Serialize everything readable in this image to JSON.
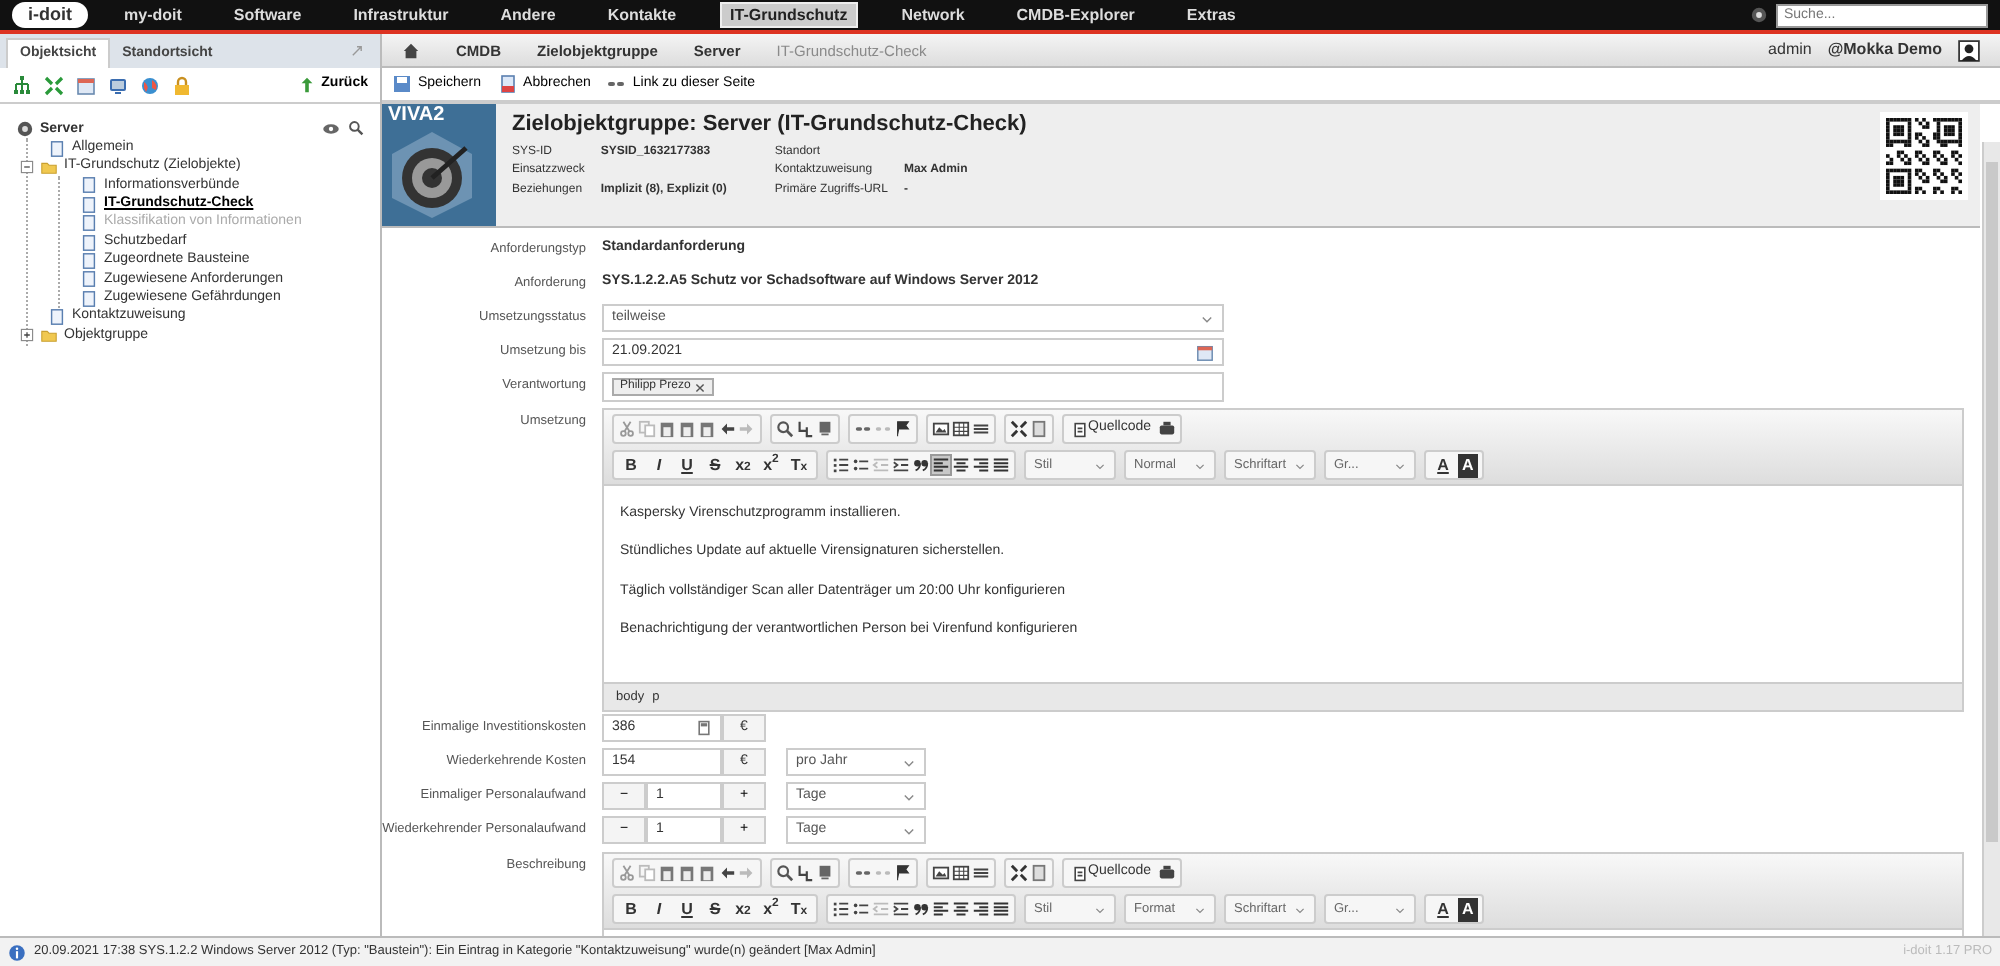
{
  "nav": {
    "logo": "i-doit",
    "items": [
      {
        "label": "my-doit",
        "selected": false
      },
      {
        "label": "Software",
        "selected": false
      },
      {
        "label": "Infrastruktur",
        "selected": false
      },
      {
        "label": "Andere",
        "selected": false
      },
      {
        "label": "Kontakte",
        "selected": false
      },
      {
        "label": "IT-Grundschutz",
        "selected": true
      },
      {
        "label": "Network",
        "selected": false
      },
      {
        "label": "CMDB-Explorer",
        "selected": false
      },
      {
        "label": "Extras",
        "selected": false
      }
    ],
    "search": {
      "placeholder": "Suche..."
    }
  },
  "sidebar": {
    "tabs": [
      {
        "label": "Objektsicht",
        "selected": true
      },
      {
        "label": "Standortsicht",
        "selected": false
      }
    ],
    "back": "Zurück",
    "tree": {
      "label": "Server",
      "children": [
        {
          "label": "Allgemein",
          "kind": "page",
          "selected": false,
          "disabled": false
        },
        {
          "label": "IT-Grundschutz (Zielobjekte)",
          "kind": "folder",
          "expanded": true,
          "selected": false,
          "disabled": false,
          "children": [
            {
              "label": "Informationsverbünde",
              "kind": "page",
              "selected": false,
              "disabled": false
            },
            {
              "label": "IT-Grundschutz-Check",
              "kind": "page",
              "selected": true,
              "disabled": false
            },
            {
              "label": "Klassifikation von Informationen",
              "kind": "page",
              "selected": false,
              "disabled": true
            },
            {
              "label": "Schutzbedarf",
              "kind": "page",
              "selected": false,
              "disabled": false
            },
            {
              "label": "Zugeordnete Bausteine",
              "kind": "page",
              "selected": false,
              "disabled": false
            },
            {
              "label": "Zugewiesene Anforderungen",
              "kind": "page",
              "selected": false,
              "disabled": false
            },
            {
              "label": "Zugewiesene Gefährdungen",
              "kind": "page",
              "selected": false,
              "disabled": false
            }
          ]
        },
        {
          "label": "Kontaktzuweisung",
          "kind": "page",
          "selected": false,
          "disabled": false
        },
        {
          "label": "Objektgruppe",
          "kind": "folder",
          "expanded": false,
          "selected": false,
          "disabled": false
        }
      ]
    }
  },
  "breadcrumb": [
    {
      "label": "CMDB",
      "selected": false
    },
    {
      "label": "Zielobjektgruppe",
      "selected": false
    },
    {
      "label": "Server",
      "selected": false
    },
    {
      "label": "IT-Grundschutz-Check",
      "selected": true
    }
  ],
  "user": {
    "name": "admin",
    "tenant": "@Mokka Demo"
  },
  "actions": [
    {
      "kind": "save",
      "label": "Speichern"
    },
    {
      "kind": "cancel",
      "label": "Abbrechen"
    },
    {
      "kind": "link",
      "label": "Link zu dieser Seite"
    }
  ],
  "header": {
    "logo_text": "VIVA2",
    "title": "Zielobjektgruppe: Server (IT-Grundschutz-Check)",
    "fields_left": [
      {
        "label": "SYS-ID",
        "value": "SYSID_1632177383"
      },
      {
        "label": "Einsatzzweck"
      },
      {
        "label": "Beziehungen",
        "value": "Implizit (8), Explizit (0)"
      }
    ],
    "fields_right": [
      {
        "label": "Standort"
      },
      {
        "label": "Kontaktzuweisung",
        "value": "Max Admin"
      },
      {
        "label": "Primäre Zugriffs-URL",
        "value": "-"
      }
    ]
  },
  "form": [
    {
      "kind": "text",
      "label": "Anforderungstyp",
      "value": "Standardanforderung"
    },
    {
      "kind": "text",
      "label": "Anforderung",
      "value": "SYS.1.2.2.A5 Schutz vor Schadsoftware auf Windows Server 2012"
    },
    {
      "kind": "select",
      "label": "Umsetzungsstatus",
      "value": "teilweise"
    },
    {
      "kind": "date",
      "label": "Umsetzung bis",
      "value": "21.09.2021"
    },
    {
      "kind": "tags",
      "label": "Verantwortung",
      "tags": [
        "Philipp Prezo"
      ]
    },
    {
      "kind": "editor",
      "label": "Umsetzung",
      "source_label": "Quellcode",
      "format_buttons": [
        "B",
        "I",
        "U",
        "S",
        "x$_{2}$",
        "x$^{2}$",
        "T$_{x}$"
      ],
      "left_align_active": true,
      "styles": [
        "Stil",
        "Normal",
        "Schriftart",
        "Gr..."
      ],
      "color_buttons": [
        "A",
        "A"
      ],
      "paragraphs": [
        "Kaspersky Virenschutzprogramm installieren.",
        "Stündliches Update auf aktuelle Virensignaturen sicherstellen.",
        "Täglich vollständiger Scan aller Datenträger um 20:00 Uhr konfigurieren",
        "Benachrichtigung der verantwortlichen Person bei Virenfund konfigurieren"
      ],
      "path": [
        "body",
        "p"
      ]
    },
    {
      "kind": "currency",
      "label": "Einmalige Investitionskosten",
      "value": "386",
      "unit": "€"
    },
    {
      "kind": "currency",
      "label": "Wiederkehrende Kosten",
      "value": "154",
      "unit": "€",
      "period": "pro Jahr"
    },
    {
      "kind": "stepper",
      "label": "Einmaliger Personalaufwand",
      "value": "1",
      "minus": "−",
      "plus": "+",
      "period": "Tage"
    },
    {
      "kind": "stepper",
      "label": "Wiederkehrender Personalaufwand",
      "value": "1",
      "minus": "−",
      "plus": "+",
      "period": "Tage"
    },
    {
      "kind": "editor",
      "label": "Beschreibung",
      "source_label": "Quellcode",
      "format_buttons": [
        "B",
        "I",
        "U",
        "S",
        "x$_{2}$",
        "x$^{2}$",
        "T$_{x}$"
      ],
      "left_align_active": false,
      "styles": [
        "Stil",
        "Format",
        "Schriftart",
        "Gr..."
      ],
      "color_buttons": [
        "A",
        "A"
      ]
    }
  ],
  "status_bar": {
    "message": "20.09.2021 17:38 SYS.1.2.2 Windows Server 2012 (Typ: \"Baustein\"): Ein Eintrag in Kategorie \"Kontaktzuweisung\" wurde(n) geändert [Max Admin]",
    "version": "i-doit 1.17 PRO"
  }
}
